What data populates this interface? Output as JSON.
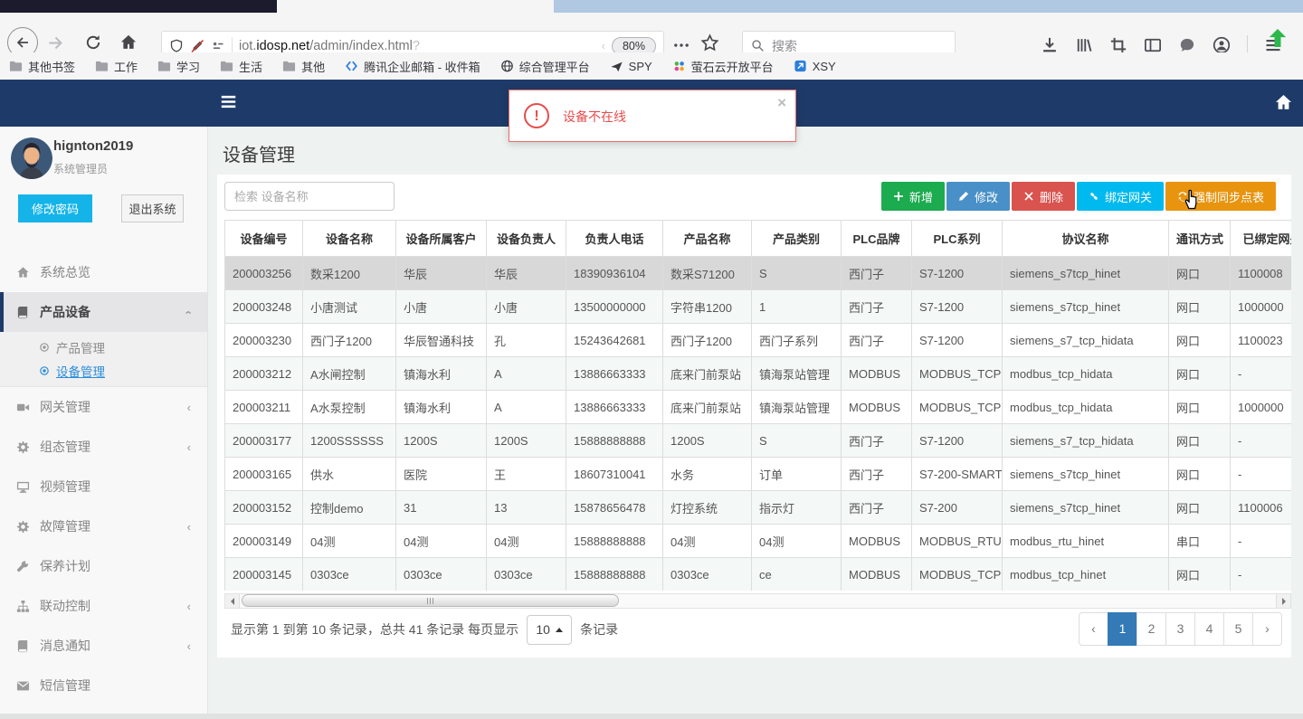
{
  "browser": {
    "url": {
      "subdomain": "iot.",
      "domain": "idosp.net",
      "path": "/admin/index.html",
      "query": "?"
    },
    "zoom_level": "80%",
    "search_placeholder": "搜索",
    "bookmarks": [
      {
        "label": "其他书签",
        "icon": "folder"
      },
      {
        "label": "工作",
        "icon": "folder"
      },
      {
        "label": "学习",
        "icon": "folder"
      },
      {
        "label": "生活",
        "icon": "folder"
      },
      {
        "label": "其他",
        "icon": "folder"
      },
      {
        "label": "腾讯企业邮箱 - 收件箱",
        "icon": "tencent"
      },
      {
        "label": "综合管理平台",
        "icon": "globe"
      },
      {
        "label": "SPY",
        "icon": "spy"
      },
      {
        "label": "萤石云开放平台",
        "icon": "ys"
      },
      {
        "label": "XSY",
        "icon": "xsy"
      }
    ]
  },
  "app": {
    "alert": {
      "message": "设备不在线",
      "close": "×"
    },
    "sidebar": {
      "username": "hignton2019",
      "role": "系统管理员",
      "change_password_label": "修改密码",
      "logout_label": "退出系统",
      "menu": [
        {
          "label": "系统总览",
          "icon": "home"
        },
        {
          "label": "产品设备",
          "icon": "book",
          "active": true,
          "chevron": "down"
        },
        {
          "label": "产品管理",
          "icon": "dot",
          "sub": true
        },
        {
          "label": "设备管理",
          "icon": "dot",
          "sub": true,
          "selected": true
        },
        {
          "label": "网关管理",
          "icon": "video",
          "chevron": "left"
        },
        {
          "label": "组态管理",
          "icon": "gear",
          "chevron": "left"
        },
        {
          "label": "视频管理",
          "icon": "desktop"
        },
        {
          "label": "故障管理",
          "icon": "gear",
          "chevron": "left"
        },
        {
          "label": "保养计划",
          "icon": "wrench"
        },
        {
          "label": "联动控制",
          "icon": "sitemap",
          "chevron": "left"
        },
        {
          "label": "消息通知",
          "icon": "book",
          "chevron": "left"
        },
        {
          "label": "短信管理",
          "icon": "envelope"
        }
      ]
    },
    "page": {
      "title": "设备管理",
      "device_search_placeholder": "检索 设备名称",
      "toolbar": [
        {
          "label": "新增",
          "icon": "plus",
          "color": "#1cab4f"
        },
        {
          "label": "修改",
          "icon": "pencil",
          "color": "#4a90c8"
        },
        {
          "label": "删除",
          "icon": "cross",
          "color": "#d9534f"
        },
        {
          "label": "绑定网关",
          "icon": "link",
          "color": "#00b9ef"
        },
        {
          "label": "强制同步点表",
          "icon": "sync",
          "color": "#e8940f"
        }
      ],
      "table": {
        "headers": [
          "设备编号",
          "设备名称",
          "设备所属客户",
          "设备负责人",
          "负责人电话",
          "产品名称",
          "产品类别",
          "PLC品牌",
          "PLC系列",
          "协议名称",
          "通讯方式",
          "已绑定网关"
        ],
        "rows": [
          [
            "200003256",
            "数采1200",
            "华辰",
            "华辰",
            "18390936104",
            "数采S71200",
            "S",
            "西门子",
            "S7-1200",
            "siemens_s7tcp_hinet",
            "网口",
            "1100008"
          ],
          [
            "200003248",
            "小唐测试",
            "小唐",
            "小唐",
            "13500000000",
            "字符串1200",
            "1",
            "西门子",
            "S7-1200",
            "siemens_s7tcp_hinet",
            "网口",
            "1000000"
          ],
          [
            "200003230",
            "西门子1200",
            "华辰智通科技",
            "孔",
            "15243642681",
            "西门子1200",
            "西门子系列",
            "西门子",
            "S7-1200",
            "siemens_s7_tcp_hidata",
            "网口",
            "1100023"
          ],
          [
            "200003212",
            "A水闸控制",
            "镇海水利",
            "A",
            "13886663333",
            "底来门前泵站",
            "镇海泵站管理",
            "MODBUS",
            "MODBUS_TCP",
            "modbus_tcp_hidata",
            "网口",
            "-"
          ],
          [
            "200003211",
            "A水泵控制",
            "镇海水利",
            "A",
            "13886663333",
            "底来门前泵站",
            "镇海泵站管理",
            "MODBUS",
            "MODBUS_TCP",
            "modbus_tcp_hidata",
            "网口",
            "1000000"
          ],
          [
            "200003177",
            "1200SSSSSS",
            "1200S",
            "1200S",
            "15888888888",
            "1200S",
            "S",
            "西门子",
            "S7-1200",
            "siemens_s7_tcp_hidata",
            "网口",
            "-"
          ],
          [
            "200003165",
            "供水",
            "医院",
            "王",
            "18607310041",
            "水务",
            "订单",
            "西门子",
            "S7-200-SMART",
            "siemens_s7tcp_hinet",
            "网口",
            "-"
          ],
          [
            "200003152",
            "控制demo",
            "31",
            "13",
            "15878656478",
            "灯控系统",
            "指示灯",
            "西门子",
            "S7-200",
            "siemens_s7tcp_hinet",
            "网口",
            "1100006"
          ],
          [
            "200003149",
            "04测",
            "04测",
            "04测",
            "15888888888",
            "04测",
            "04测",
            "MODBUS",
            "MODBUS_RTU",
            "modbus_rtu_hinet",
            "串口",
            "-"
          ],
          [
            "200003145",
            "0303ce",
            "0303ce",
            "0303ce",
            "15888888888",
            "0303ce",
            "ce",
            "MODBUS",
            "MODBUS_TCP",
            "modbus_tcp_hinet",
            "网口",
            "-"
          ]
        ],
        "selected_row_index": 0
      },
      "pagination": {
        "info": "显示第 1 到第 10 条记录，总共 41 条记录 每页显示",
        "page_size": "10",
        "suffix": "条记录",
        "prev": "‹",
        "next": "›",
        "pages": [
          "1",
          "2",
          "3",
          "4",
          "5"
        ],
        "active_page": "1"
      }
    },
    "colors": {
      "navbar": "#1e3a68",
      "selected_link": "#2d8cd8",
      "change_password_btn": "#14b4e9",
      "alert_red": "#e64c4c",
      "pagination_active": "#337ab7"
    }
  }
}
